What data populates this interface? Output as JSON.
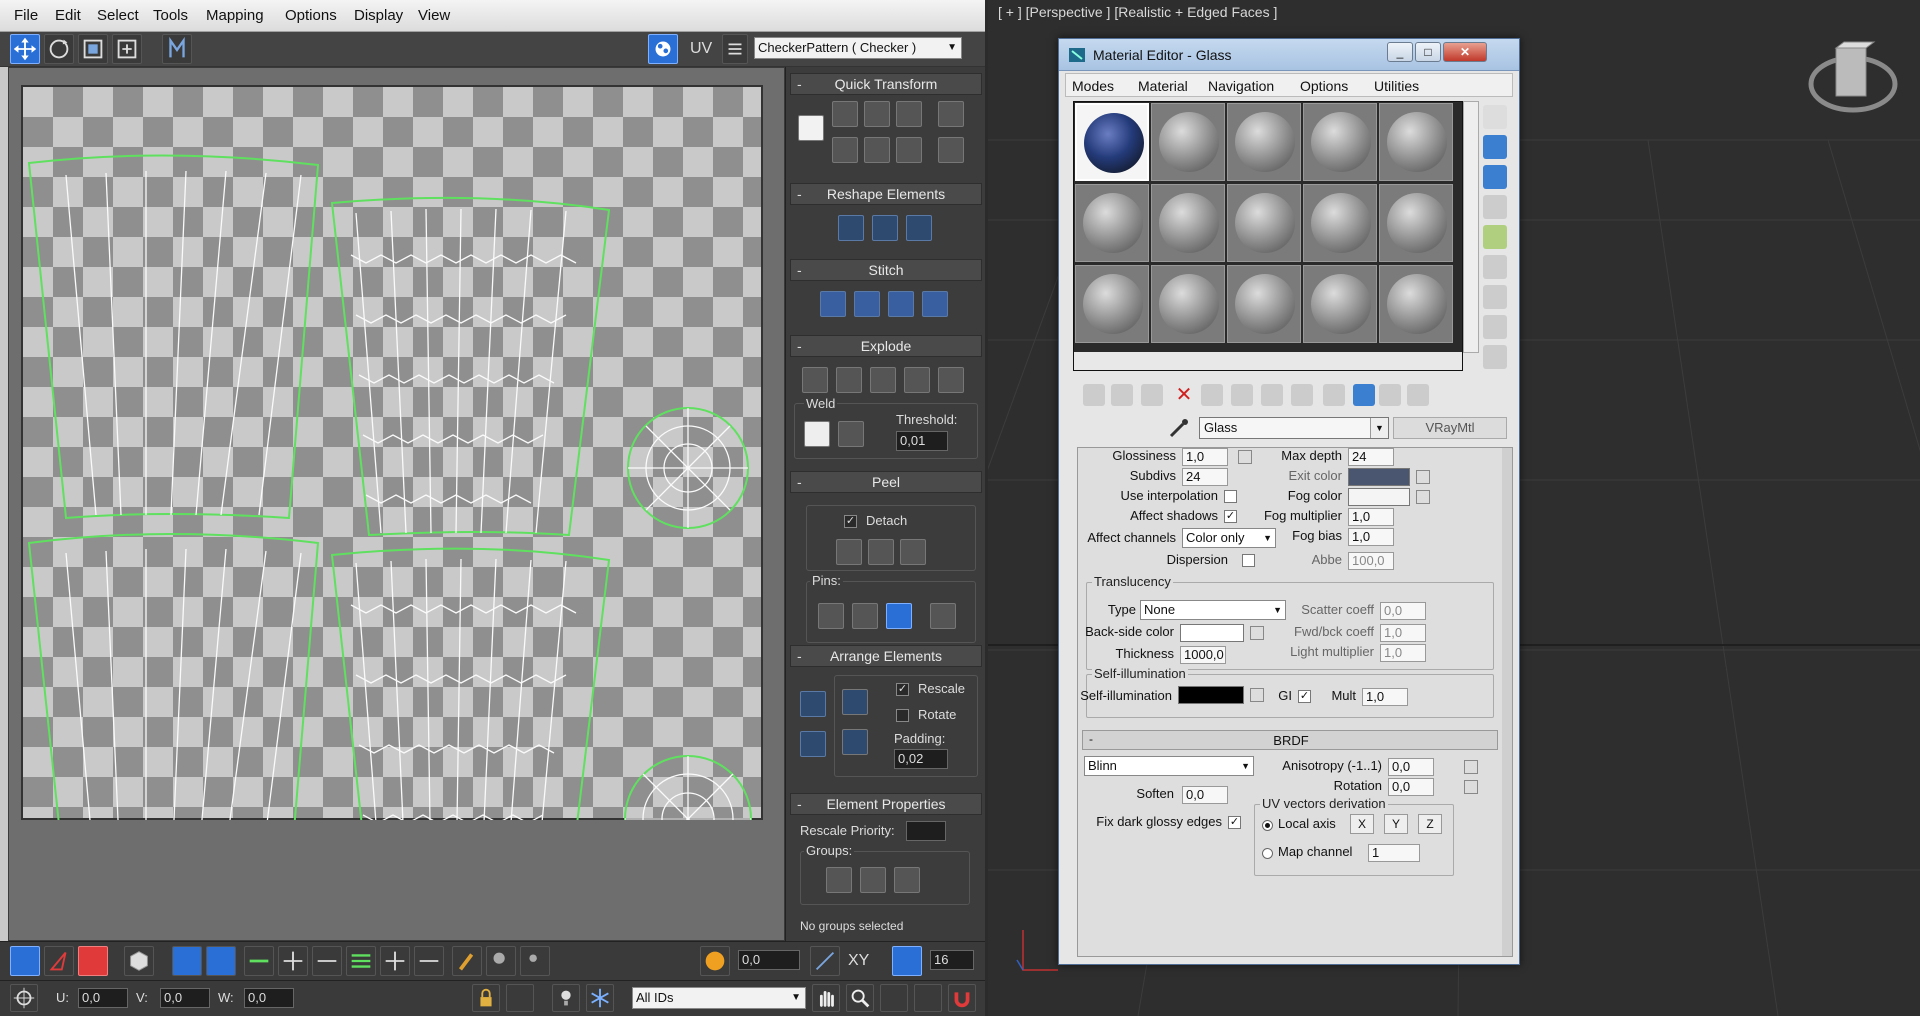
{
  "uv_editor": {
    "menu": [
      "File",
      "Edit",
      "Select",
      "Tools",
      "Mapping",
      "Options",
      "Display",
      "View"
    ],
    "toolbar": {
      "uv_label": "UV",
      "texture_dropdown": "CheckerPattern  ( Checker )"
    },
    "panel": {
      "quick_transform": "Quick Transform",
      "reshape_elements": "Reshape Elements",
      "stitch": "Stitch",
      "explode": "Explode",
      "weld_label": "Weld",
      "threshold_label": "Threshold:",
      "threshold_value": "0,01",
      "peel": "Peel",
      "detach_label": "Detach",
      "pins_label": "Pins:",
      "arrange_elements": "Arrange Elements",
      "rescale_label": "Rescale",
      "rotate_label": "Rotate",
      "padding_label": "Padding:",
      "padding_value": "0,02",
      "element_properties": "Element Properties",
      "rescale_priority_label": "Rescale Priority:",
      "groups_label": "Groups:",
      "no_groups": "No groups selected"
    },
    "bottom": {
      "soft_value": "0,0",
      "xy_label": "XY",
      "grid_value": "16",
      "u_label": "U:",
      "u_value": "0,0",
      "v_label": "V:",
      "v_value": "0,0",
      "w_label": "W:",
      "w_value": "0,0",
      "ids_dropdown": "All IDs"
    }
  },
  "viewport": {
    "label": "[ + ] [Perspective ] [Realistic + Edged Faces ]"
  },
  "material_editor": {
    "title": "Material Editor - Glass",
    "menu": [
      "Modes",
      "Material",
      "Navigation",
      "Options",
      "Utilities"
    ],
    "material_name": "Glass",
    "material_type": "VRayMtl",
    "refraction": {
      "glossiness_label": "Glossiness",
      "glossiness_value": "1,0",
      "subdivs_label": "Subdivs",
      "subdivs_value": "24",
      "use_interp_label": "Use interpolation",
      "affect_shadows_label": "Affect shadows",
      "affect_channels_label": "Affect channels",
      "affect_channels_value": "Color only",
      "dispersion_label": "Dispersion",
      "max_depth_label": "Max depth",
      "max_depth_value": "24",
      "exit_color_label": "Exit color",
      "fog_color_label": "Fog color",
      "fog_mult_label": "Fog multiplier",
      "fog_mult_value": "1,0",
      "fog_bias_label": "Fog bias",
      "fog_bias_value": "1,0",
      "abbe_label": "Abbe",
      "abbe_value": "100,0"
    },
    "translucency": {
      "title": "Translucency",
      "type_label": "Type",
      "type_value": "None",
      "backside_label": "Back-side color",
      "thickness_label": "Thickness",
      "thickness_value": "1000,0",
      "scatter_label": "Scatter coeff",
      "scatter_value": "0,0",
      "fwd_label": "Fwd/bck coeff",
      "fwd_value": "1,0",
      "light_mult_label": "Light multiplier",
      "light_mult_value": "1,0"
    },
    "self_illum": {
      "title": "Self-illumination",
      "label": "Self-illumination",
      "gi_label": "GI",
      "mult_label": "Mult",
      "mult_value": "1,0"
    },
    "brdf": {
      "title": "BRDF",
      "type_value": "Blinn",
      "anisotropy_label": "Anisotropy (-1..1)",
      "anisotropy_value": "0,0",
      "rotation_label": "Rotation",
      "rotation_value": "0,0",
      "soften_label": "Soften",
      "soften_value": "0,0",
      "fix_dark_label": "Fix dark glossy edges",
      "uv_group_title": "UV vectors derivation",
      "local_axis_label": "Local axis",
      "x_label": "X",
      "y_label": "Y",
      "z_label": "Z",
      "map_channel_label": "Map channel",
      "map_channel_value": "1"
    }
  },
  "colors": {
    "selection_green": "#5fe05f",
    "accent_blue": "#2a6fd6",
    "exit_color": "#4a5670",
    "fog_color": "#f4f4f4",
    "backside_color": "#ffffff",
    "self_illum_color": "#000000"
  }
}
